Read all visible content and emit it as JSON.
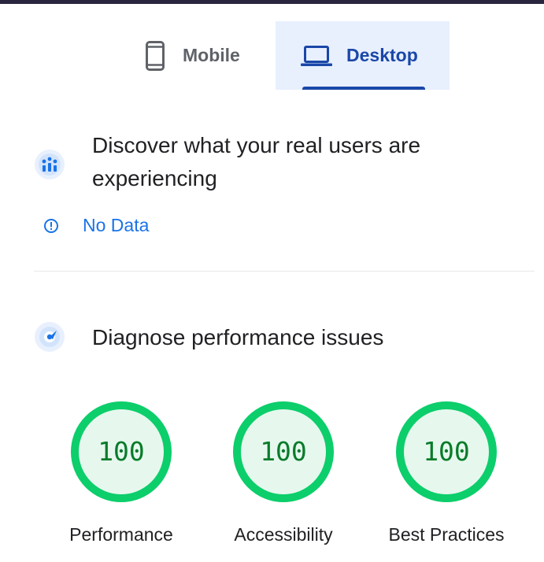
{
  "tabs": [
    {
      "label": "Mobile",
      "icon": "phone-icon",
      "selected": false
    },
    {
      "label": "Desktop",
      "icon": "laptop-icon",
      "selected": true
    }
  ],
  "crux": {
    "title": "Discover what your real users are experiencing",
    "icon": "users-chart-icon",
    "status": "No Data",
    "status_icon": "info-icon"
  },
  "lighthouse": {
    "title": "Diagnose performance issues",
    "icon": "lighthouse-icon",
    "gauges": [
      {
        "score": "100",
        "label": "Performance",
        "level": 1.0
      },
      {
        "score": "100",
        "label": "Accessibility",
        "level": 1.0
      },
      {
        "score": "100",
        "label": "Best Practices",
        "level": 1.0
      }
    ]
  },
  "colors": {
    "accent": "#1a47a8",
    "link": "#1a73e8",
    "tab_selected_bg": "#e8f0fe",
    "pass_ring": "#0cce6b",
    "pass_fill": "#e6f8ee",
    "pass_text": "#0a7b2a"
  }
}
